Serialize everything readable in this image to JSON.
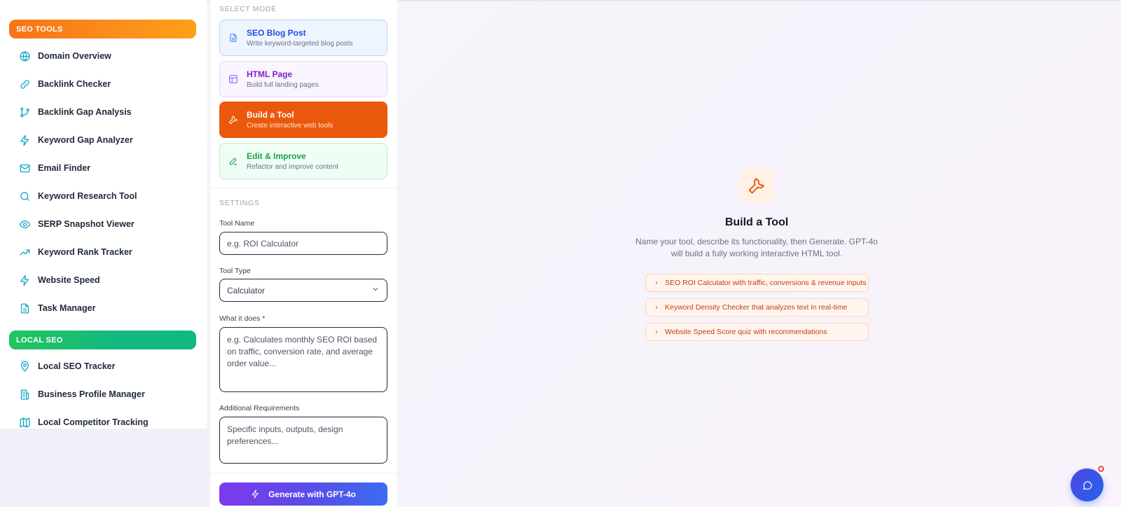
{
  "sidebar": {
    "seo_header": "SEO TOOLS",
    "seo_items": [
      {
        "label": "Domain Overview",
        "icon": "globe-icon"
      },
      {
        "label": "Backlink Checker",
        "icon": "link-icon"
      },
      {
        "label": "Backlink Gap Analysis",
        "icon": "git-branch-icon"
      },
      {
        "label": "Keyword Gap Analyzer",
        "icon": "lightning-icon"
      },
      {
        "label": "Email Finder",
        "icon": "mail-icon"
      },
      {
        "label": "Keyword Research Tool",
        "icon": "search-icon"
      },
      {
        "label": "SERP Snapshot Viewer",
        "icon": "eye-icon"
      },
      {
        "label": "Keyword Rank Tracker",
        "icon": "trending-up-icon"
      },
      {
        "label": "Website Speed",
        "icon": "lightning-icon"
      },
      {
        "label": "Task Manager",
        "icon": "document-icon"
      }
    ],
    "local_header": "LOCAL SEO",
    "local_items": [
      {
        "label": "Local SEO Tracker",
        "icon": "map-pin-icon"
      },
      {
        "label": "Business Profile Manager",
        "icon": "building-icon"
      },
      {
        "label": "Local Competitor Tracking",
        "icon": "map-icon"
      }
    ]
  },
  "panel": {
    "select_mode_label": "SELECT MODE",
    "modes": [
      {
        "title": "SEO Blog Post",
        "subtitle": "Write keyword-targeted blog posts",
        "icon": "document-icon"
      },
      {
        "title": "HTML Page",
        "subtitle": "Build full landing pages",
        "icon": "layout-icon"
      },
      {
        "title": "Build a Tool",
        "subtitle": "Create interactive web tools",
        "icon": "wrench-icon"
      },
      {
        "title": "Edit & Improve",
        "subtitle": "Refactor and improve content",
        "icon": "pencil-icon"
      }
    ],
    "selected_mode": "Build a Tool",
    "settings_label": "SETTINGS",
    "tool_name": {
      "label": "Tool Name",
      "placeholder": "e.g. ROI Calculator",
      "value": ""
    },
    "tool_type": {
      "label": "Tool Type",
      "value": "Calculator"
    },
    "what_it_does": {
      "label": "What it does *",
      "placeholder": "e.g. Calculates monthly SEO ROI based on traffic, conversion rate, and average order value...",
      "value": ""
    },
    "additional": {
      "label": "Additional Requirements",
      "placeholder": "Specific inputs, outputs, design preferences...",
      "value": ""
    },
    "generate_label": "Generate with GPT-4o"
  },
  "main": {
    "title": "Build a Tool",
    "description": "Name your tool, describe its functionality, then Generate. GPT-4o will build a fully working interactive HTML tool.",
    "suggestions": [
      "SEO ROI Calculator with traffic, conversions & revenue inputs",
      "Keyword Density Checker that analyzes text in real-time",
      "Website Speed Score quiz with recommendations"
    ]
  },
  "colors": {
    "seo_header_from": "#f97316",
    "local_header_from": "#22c55e",
    "active_mode": "#ea580c",
    "icon_teal": "#0ea5c6",
    "generate_from": "#7c3aed",
    "generate_to": "#3b6cf0"
  },
  "chat": {
    "icon": "chat-bubble-icon"
  }
}
